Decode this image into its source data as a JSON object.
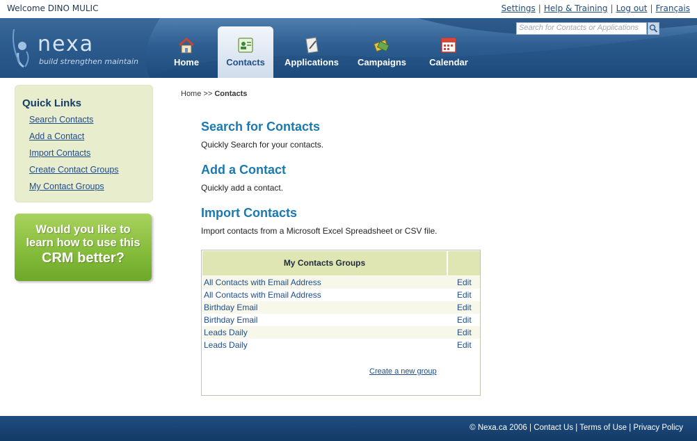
{
  "topbar": {
    "welcome": "Welcome DINO MULIC",
    "links": [
      "Settings",
      "Help & Training",
      "Log out",
      "Français"
    ]
  },
  "logo": {
    "word": "nexa",
    "tagline": "build strengthen maintain"
  },
  "nav": {
    "items": [
      {
        "label": "Home",
        "icon": "house-icon"
      },
      {
        "label": "Contacts",
        "icon": "contacts-icon",
        "active": true
      },
      {
        "label": "Applications",
        "icon": "applications-icon"
      },
      {
        "label": "Campaigns",
        "icon": "campaigns-icon"
      },
      {
        "label": "Calendar",
        "icon": "calendar-icon"
      }
    ]
  },
  "search": {
    "placeholder": "Search for Contacts or Applications"
  },
  "sidebar": {
    "title": "Quick Links",
    "links": [
      "Search Contacts",
      "Add a Contact",
      "Import Contacts",
      "Create Contact Groups",
      "My Contact Groups"
    ],
    "promo": {
      "line1": "Would you like to",
      "line2": "learn how to use this",
      "line3": "CRM better?"
    }
  },
  "breadcrumb": {
    "home": "Home",
    "separator": ">>",
    "current": "Contacts"
  },
  "sections": [
    {
      "title": "Search for Contacts",
      "desc": "Quickly Search for your contacts."
    },
    {
      "title": "Add a Contact",
      "desc": "Quickly add a contact."
    },
    {
      "title": "Import Contacts",
      "desc": "Import contacts from a Microsoft Excel Spreadsheet or CSV file."
    }
  ],
  "groups": {
    "header": "My Contacts Groups",
    "rows": [
      {
        "name": "All Contacts with Email Address",
        "edit": "Edit"
      },
      {
        "name": "All Contacts with Email Address",
        "edit": "Edit"
      },
      {
        "name": "Birthday Email",
        "edit": "Edit"
      },
      {
        "name": "Birthday Email",
        "edit": "Edit"
      },
      {
        "name": "Leads Daily",
        "edit": "Edit"
      },
      {
        "name": "Leads Daily",
        "edit": "Edit"
      }
    ],
    "create_link": "Create a new group"
  },
  "footer": {
    "copyright": "© Nexa.ca 2006",
    "links": [
      "Contact Us",
      "Terms of Use",
      "Privacy Policy"
    ]
  },
  "colors": {
    "header_blue": "#2f5f92",
    "section_title": "#1a7ab0",
    "sidebar_bg": "#e8edce",
    "promo_green": "#86bd3b",
    "footer_blue": "#1e4d80"
  }
}
